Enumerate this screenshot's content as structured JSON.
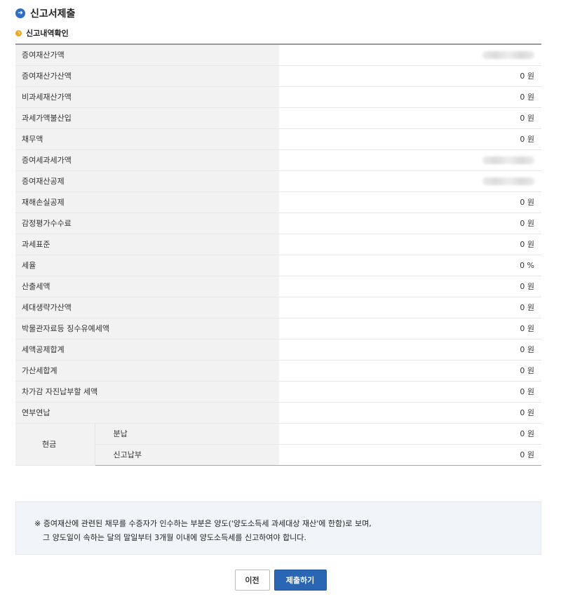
{
  "page_title": "신고서제출",
  "section_title": "신고내역확인",
  "rows": [
    {
      "label": "증여재산가액",
      "value": ""
    },
    {
      "label": "증여재산가산액",
      "value": "0 원"
    },
    {
      "label": "비과세재산가액",
      "value": "0 원"
    },
    {
      "label": "과세가액불산입",
      "value": "0 원"
    },
    {
      "label": "채무액",
      "value": "0 원"
    },
    {
      "label": "증여세과세가액",
      "value": ""
    },
    {
      "label": "증여재산공제",
      "value": ""
    },
    {
      "label": "재해손실공제",
      "value": "0 원"
    },
    {
      "label": "감정평가수수료",
      "value": "0 원"
    },
    {
      "label": "과세표준",
      "value": "0 원"
    },
    {
      "label": "세율",
      "value": "0 %"
    },
    {
      "label": "산출세액",
      "value": "0 원"
    },
    {
      "label": "세대생략가산액",
      "value": "0 원"
    },
    {
      "label": "박물관자료등 징수유예세액",
      "value": "0 원"
    },
    {
      "label": "세액공제합계",
      "value": "0 원"
    },
    {
      "label": "가산세합계",
      "value": "0 원"
    },
    {
      "label": "차가감 자진납부할 세액",
      "value": "0 원"
    },
    {
      "label": "연부연납",
      "value": "0 원"
    }
  ],
  "cash": {
    "label": "현금",
    "installment_label": "분납",
    "installment_value": "0 원",
    "declared_label": "신고납부",
    "declared_value": "0 원"
  },
  "notice": {
    "line1": "※ 증여재산에 관련된 채무를 수증자가 인수하는 부분은 양도('양도소득세 과세대상 재산'에 한함)로 보며,",
    "line2": "그 양도일이 속하는 달의 말일부터 3개월 이내에 양도소득세를 신고하여야 합니다."
  },
  "buttons": {
    "prev": "이전",
    "submit": "제출하기"
  },
  "colors": {
    "accent": "#2b66b5",
    "section_icon": "#f4a31a"
  }
}
